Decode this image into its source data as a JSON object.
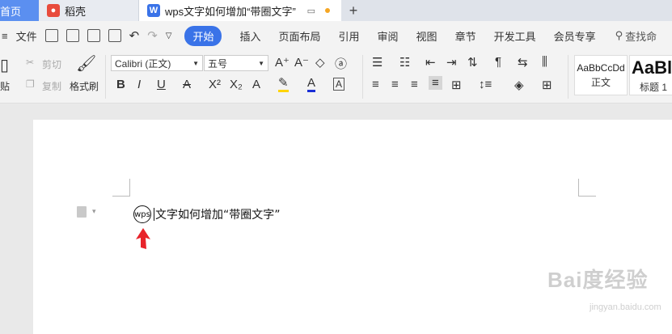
{
  "tabs": {
    "home": "首页",
    "daoke": "稻壳",
    "doc": "wps文字如何增加“带圈文字”",
    "add": "+"
  },
  "menu": {
    "file": "文件",
    "items": [
      "开始",
      "插入",
      "页面布局",
      "引用",
      "审阅",
      "视图",
      "章节",
      "开发工具",
      "会员专享"
    ],
    "search": "查找命"
  },
  "ribbon": {
    "cut": "剪切",
    "copy": "复制",
    "paste": "贴",
    "format_painter": "格式刷",
    "font_name": "Calibri (正文)",
    "font_size": "五号",
    "styles": [
      {
        "sample": "AaBbCcDd",
        "caption": "正文"
      },
      {
        "sample": "AaBl",
        "caption": "标题 1"
      }
    ],
    "font_color": "#ff0000",
    "highlight_color": "#ffd400"
  },
  "document": {
    "circled_text": "wps",
    "rest_text": "文字如何增加“带圈文字”"
  },
  "watermark": {
    "main": "Bai度经验",
    "sub": "jingyan.baidu.com"
  }
}
